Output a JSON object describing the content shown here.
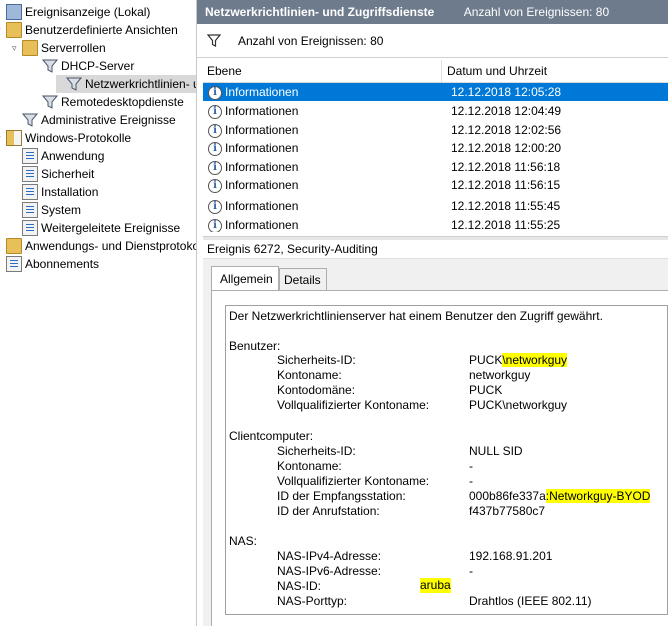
{
  "tree": {
    "items": [
      {
        "label": "Ereignisanzeige (Lokal)",
        "icon": "event-viewer-icon",
        "tw": "",
        "depth": 0
      },
      {
        "label": "Benutzerdefinierte Ansichten",
        "icon": "folder-icon",
        "tw": "▿",
        "depth": 0
      },
      {
        "label": "Serverrollen",
        "icon": "folder-icon",
        "tw": "▿",
        "depth": 1
      },
      {
        "label": "DHCP-Server",
        "icon": "filter-icon",
        "tw": "",
        "depth": 2
      },
      {
        "label": "Netzwerkrichtlinien- und Zugriffsdienste",
        "icon": "filter-icon",
        "tw": "",
        "depth": 2,
        "selected": true
      },
      {
        "label": "Remotedesktopdienste",
        "icon": "filter-icon",
        "tw": "",
        "depth": 2
      },
      {
        "label": "Administrative Ereignisse",
        "icon": "filter-icon",
        "tw": "",
        "depth": 1
      },
      {
        "label": "Windows-Protokolle",
        "icon": "folder-icon",
        "tw": "▿",
        "depth": 0
      },
      {
        "label": "Anwendung",
        "icon": "log-icon",
        "tw": "",
        "depth": 1
      },
      {
        "label": "Sicherheit",
        "icon": "log-icon",
        "tw": "",
        "depth": 1
      },
      {
        "label": "Installation",
        "icon": "log-icon",
        "tw": "",
        "depth": 1
      },
      {
        "label": "System",
        "icon": "log-icon",
        "tw": "",
        "depth": 1
      },
      {
        "label": "Weitergeleitete Ereignisse",
        "icon": "log-icon",
        "tw": "",
        "depth": 1
      },
      {
        "label": "Anwendungs- und Dienstprotokolle",
        "icon": "folder-icon",
        "tw": "▹",
        "depth": 0
      },
      {
        "label": "Abonnements",
        "icon": "log-icon",
        "tw": "",
        "depth": 0
      }
    ]
  },
  "header": {
    "title": "Netzwerkrichtlinien- und Zugriffsdienste",
    "count": "Anzahl von Ereignissen: 80"
  },
  "filterbar": {
    "count": "Anzahl von Ereignissen: 80"
  },
  "table": {
    "col_level": "Ebene",
    "col_date": "Datum und Uhrzeit",
    "rows": [
      {
        "level": "Informationen",
        "date": "12.12.2018 12:05:28"
      },
      {
        "level": "Informationen",
        "date": "12.12.2018 12:04:49"
      },
      {
        "level": "Informationen",
        "date": "12.12.2018 12:02:56"
      },
      {
        "level": "Informationen",
        "date": "12.12.2018 12:00:20"
      },
      {
        "level": "Informationen",
        "date": "12.12.2018 11:56:18"
      },
      {
        "level": "Informationen",
        "date": "12.12.2018 11:56:15"
      },
      {
        "level": "Informationen",
        "date": "12.12.2018 11:55:45"
      },
      {
        "level": "Informationen",
        "date": "12.12.2018 11:55:25"
      }
    ]
  },
  "detail_header": "Ereignis 6272, Security-Auditing",
  "tabs": {
    "general": "Allgemein",
    "details": "Details"
  },
  "detail": {
    "intro": "Der Netzwerkrichtlinienserver hat einem Benutzer den Zugriff gewährt.",
    "user_section": "Benutzer:",
    "sec_id_label": "Sicherheits-ID:",
    "sec_id_prefix": "PUCK",
    "sec_id_hl": "\\networkguy",
    "acct_label": "Kontoname:",
    "acct_value": "networkguy",
    "domain_label": "Kontodomäne:",
    "domain_value": "PUCK",
    "fq_label": "Vollqualifizierter Kontoname:",
    "fq_value": "PUCK\\networkguy",
    "client_section": "Clientcomputer:",
    "c_sec_label": "Sicherheits-ID:",
    "c_sec_value": "NULL SID",
    "c_acct_label": "Kontoname:",
    "c_acct_value": "-",
    "c_fq_label": "Vollqualifizierter Kontoname:",
    "c_fq_value": "-",
    "station_label": "ID der Empfangsstation:",
    "station_prefix": "000b86fe337a",
    "station_hl": ":Networkguy-BYOD",
    "caller_label": "ID der Anrufstation:",
    "caller_value": "f437b77580c7",
    "nas_section": "NAS:",
    "ipv4_label": "NAS-IPv4-Adresse:",
    "ipv4_value": "192.168.91.201",
    "ipv6_label": "NAS-IPv6-Adresse:",
    "ipv6_value": "-",
    "nasid_label": "NAS-ID:",
    "nasid_value": "aruba",
    "port_label": "NAS-Porttyp:",
    "port_value": "Drahtlos (IEEE 802.11)"
  },
  "colors": {
    "selection": "#0078d7",
    "header_bg": "#6e7b8c",
    "highlight": "#ffff00"
  }
}
